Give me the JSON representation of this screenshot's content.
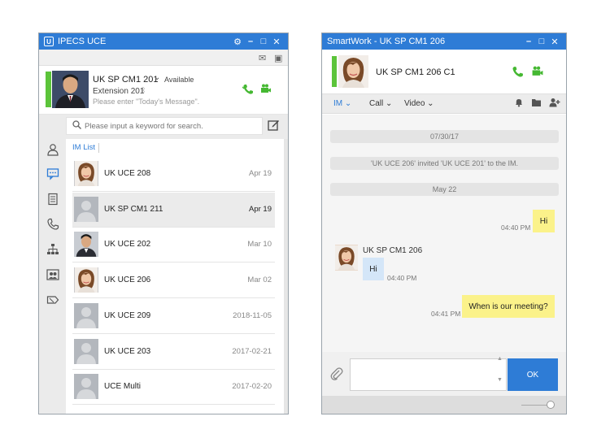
{
  "left_window": {
    "title": "IPECS UCE",
    "profile": {
      "name": "UK SP CM1 201",
      "status": "Available",
      "extension": "Extension 201",
      "message_placeholder": "Please enter \"Today's Message\"."
    },
    "search": {
      "placeholder": "Please input a keyword for search."
    },
    "list_tab": "IM List",
    "conversations": [
      {
        "name": "UK UCE 208",
        "date": "Apr 19",
        "photo": "woman"
      },
      {
        "name": "UK SP CM1 211",
        "date": "Apr 19",
        "photo": "placeholder",
        "selected": true
      },
      {
        "name": "UK UCE 202",
        "date": "Mar 10",
        "photo": "man"
      },
      {
        "name": "UK UCE 206",
        "date": "Mar 02",
        "photo": "woman"
      },
      {
        "name": "UK UCE 209",
        "date": "2018-11-05",
        "photo": "placeholder"
      },
      {
        "name": "UK UCE 203",
        "date": "2017-02-21",
        "photo": "placeholder"
      },
      {
        "name": "UCE Multi",
        "date": "2017-02-20",
        "photo": "placeholder"
      }
    ]
  },
  "right_window": {
    "title": "SmartWork - UK SP CM1 206",
    "contact_name": "UK SP CM1 206 C1",
    "tabs": {
      "im": "IM",
      "call": "Call",
      "video": "Video"
    },
    "messages": {
      "date1": "07/30/17",
      "system_notice": "'UK UCE 206' invited 'UK UCE 201' to the IM.",
      "date2": "May 22",
      "m1_text": "Hi",
      "m1_time": "04:40 PM",
      "sender_name": "UK SP CM1 206",
      "m2_text": "Hi",
      "m2_time": "04:40 PM",
      "m3_text": "When is our meeting?",
      "m3_time": "04:41 PM"
    },
    "send_label": "OK"
  },
  "colors": {
    "accent": "#2e7cd6",
    "presence": "#5cc43a",
    "call_green": "#45b832",
    "my_bubble": "#fbf28a",
    "their_bubble": "#d4e6f8"
  }
}
